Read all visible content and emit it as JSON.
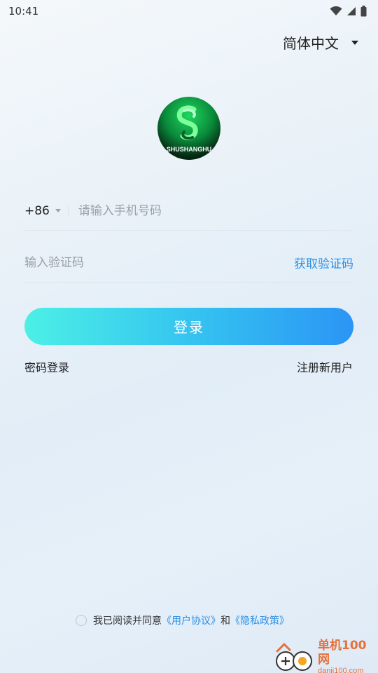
{
  "status_bar": {
    "time": "10:41",
    "icons": [
      "wifi-icon",
      "signal-icon",
      "battery-icon"
    ]
  },
  "language": {
    "label": "简体中文",
    "icon": "caret-down-icon"
  },
  "logo": {
    "text": "SHUSHANGHU",
    "colors": {
      "green": "#1fd660",
      "dark": "#000000"
    }
  },
  "login_form": {
    "country_code": "+86",
    "phone_placeholder": "请输入手机号码",
    "code_placeholder": "输入验证码",
    "get_code_label": "获取验证码",
    "login_label": "登录",
    "password_login_label": "密码登录",
    "register_label": "注册新用户"
  },
  "agreement": {
    "prefix": "我已阅读并同意",
    "user_agreement": "《用户协议》",
    "and": "和",
    "privacy_policy": "《隐私政策》"
  },
  "watermark": {
    "title": "单机100网",
    "url": "danji100.com"
  },
  "colors": {
    "accent": "#2a8fe6",
    "button_start": "#4cf0e6",
    "button_end": "#2b95f5",
    "watermark": "#e8703a"
  }
}
